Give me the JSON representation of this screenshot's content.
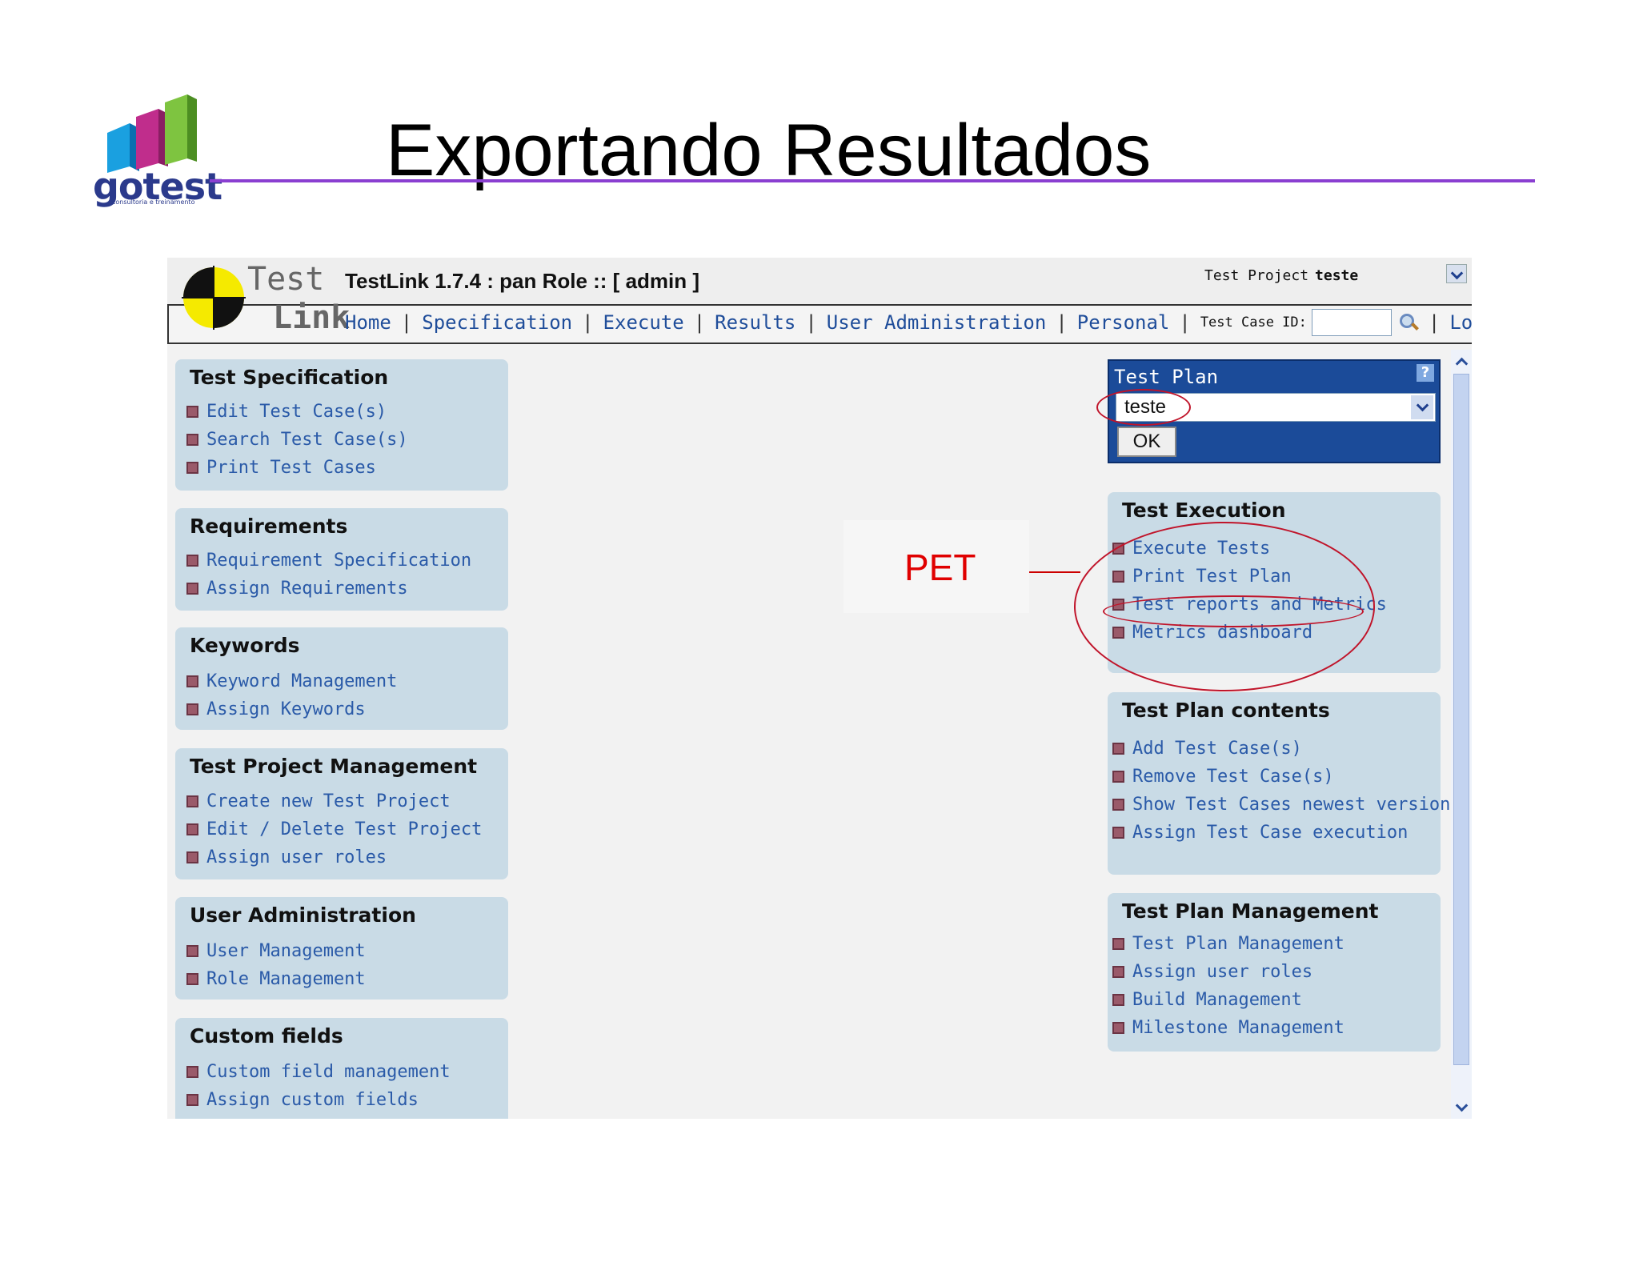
{
  "slide": {
    "title": "Exportando Resultados",
    "logo_text": "gotest",
    "logo_subtext": "consultoria e treinamento"
  },
  "app": {
    "logo_test": "Test",
    "logo_link": "Link",
    "title": "TestLink 1.7.4 : pan Role :: [ admin ]",
    "project_label": "Test Project",
    "project_value": "teste",
    "nav": {
      "items": [
        "Home",
        "Specification",
        "Execute",
        "Results",
        "User Administration",
        "Personal"
      ],
      "test_case_id_label": "Test Case ID:",
      "test_case_id_value": "",
      "logout": "Logout",
      "separator": "|"
    }
  },
  "left_panels": [
    {
      "title": "Test Specification",
      "items": [
        "Edit Test Case(s)",
        "Search Test Case(s)",
        "Print Test Cases"
      ]
    },
    {
      "title": "Requirements",
      "items": [
        "Requirement Specification",
        "Assign Requirements"
      ]
    },
    {
      "title": "Keywords",
      "items": [
        "Keyword Management",
        "Assign Keywords"
      ]
    },
    {
      "title": "Test Project Management",
      "items": [
        "Create new Test Project",
        "Edit / Delete Test Project",
        "Assign user roles"
      ]
    },
    {
      "title": "User Administration",
      "items": [
        "User Management",
        "Role Management"
      ]
    },
    {
      "title": "Custom fields",
      "items": [
        "Custom field management",
        "Assign custom fields"
      ]
    }
  ],
  "test_plan": {
    "title": "Test Plan",
    "help": "?",
    "selected": "teste",
    "ok_label": "OK"
  },
  "right_panels": [
    {
      "title": "Test Execution",
      "items": [
        "Execute Tests",
        "Print Test Plan",
        "Test reports and Metrics",
        "Metrics dashboard"
      ]
    },
    {
      "title": "Test Plan contents",
      "items": [
        "Add Test Case(s)",
        "Remove Test Case(s)",
        "Show Test Cases newest versions",
        "Assign Test Case execution"
      ]
    },
    {
      "title": "Test Plan Management",
      "items": [
        "Test Plan Management",
        "Assign user roles",
        "Build Management",
        "Milestone Management"
      ]
    }
  ],
  "annotation": {
    "label": "PET"
  },
  "colors": {
    "accent_rule": "#8a3fd1",
    "panel_bg": "#c9dbe6",
    "link": "#2a5aa8",
    "test_plan_bg": "#1b4b99",
    "annotation_red": "#e00000"
  }
}
